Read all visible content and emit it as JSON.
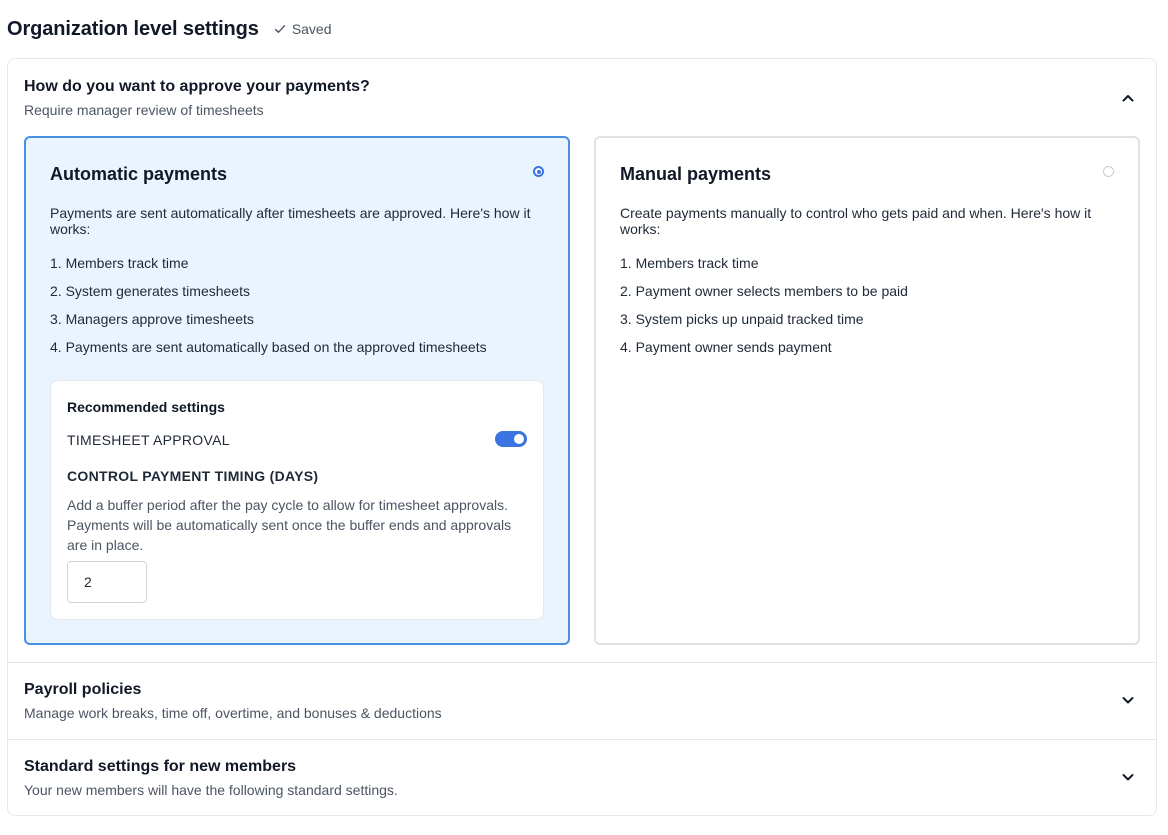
{
  "header": {
    "title": "Organization level settings",
    "saved_label": "Saved"
  },
  "approval_section": {
    "title": "How do you want to approve your payments?",
    "subtitle": "Require manager review of timesheets",
    "expanded": true,
    "options": {
      "automatic": {
        "title": "Automatic payments",
        "selected": true,
        "description": "Payments are sent automatically after timesheets are approved. Here's how it works:",
        "steps": [
          "1. Members track time",
          "2. System generates timesheets",
          "3. Managers approve timesheets",
          "4. Payments are sent automatically based on the approved timesheets"
        ],
        "recommended": {
          "title": "Recommended settings",
          "timesheet_approval_label": "TIMESHEET APPROVAL",
          "timesheet_approval_on": true,
          "timing_label": "CONTROL PAYMENT TIMING (DAYS)",
          "timing_help": "Add a buffer period after the pay cycle to allow for timesheet approvals. Payments will be automatically sent once the buffer ends and approvals are in place.",
          "timing_value": "2"
        }
      },
      "manual": {
        "title": "Manual payments",
        "selected": false,
        "description": "Create payments manually to control who gets paid and when. Here's how it works:",
        "steps": [
          "1. Members track time",
          "2. Payment owner selects members to be paid",
          "3. System picks up unpaid tracked time",
          "4. Payment owner sends payment"
        ]
      }
    }
  },
  "payroll_section": {
    "title": "Payroll policies",
    "subtitle": "Manage work breaks, time off, overtime, and bonuses & deductions",
    "expanded": false
  },
  "standard_section": {
    "title": "Standard settings for new members",
    "subtitle": "Your new members will have the following standard settings.",
    "expanded": false
  },
  "colors": {
    "accent": "#3b73e0",
    "selected_card_bg": "#eaf4fe",
    "selected_card_border": "#4a8fe0"
  }
}
